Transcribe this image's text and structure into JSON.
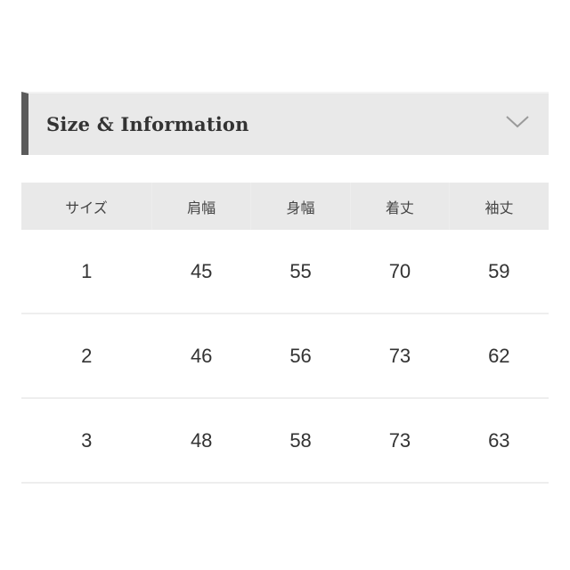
{
  "accordion": {
    "title": "Size & Information",
    "icon": "chevron-down-icon",
    "expanded": true
  },
  "table": {
    "headers": [
      "サイズ",
      "肩幅",
      "身幅",
      "着丈",
      "袖丈"
    ],
    "rows": [
      [
        "1",
        "45",
        "55",
        "70",
        "59"
      ],
      [
        "2",
        "46",
        "56",
        "73",
        "62"
      ],
      [
        "3",
        "48",
        "58",
        "73",
        "63"
      ]
    ]
  },
  "colors": {
    "header_bg": "#e9e9e9",
    "accent_bar": "#5b5b5b",
    "text": "#333333"
  }
}
